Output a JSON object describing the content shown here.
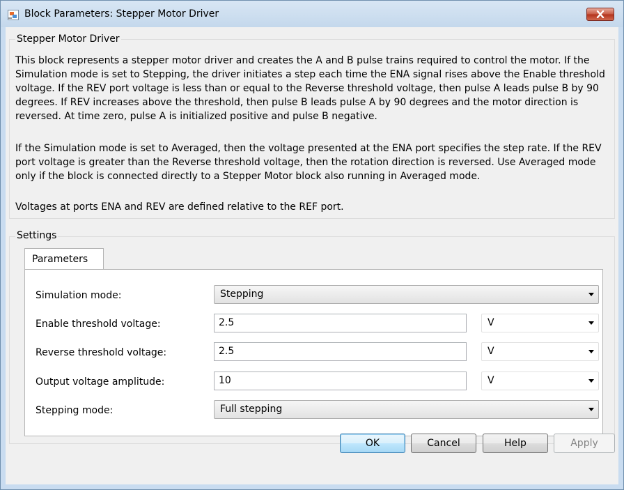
{
  "window": {
    "title": "Block Parameters: Stepper Motor Driver",
    "title_icon": "simulink-block-icon",
    "close_icon": "close-icon"
  },
  "description_group": {
    "title": "Stepper Motor Driver",
    "paragraph1": "This block represents a stepper motor driver and creates the A and B pulse trains required to control the motor. If the Simulation mode is set to Stepping, the driver initiates a step each time the ENA signal rises above the Enable threshold voltage. If the REV port voltage is less than or equal to the Reverse threshold voltage, then pulse A leads pulse B by 90 degrees. If REV increases above the threshold, then pulse B leads pulse A by 90 degrees and the motor direction is reversed. At time zero, pulse A is initialized positive and pulse B negative.",
    "paragraph2": "If the Simulation mode is set to Averaged, then the voltage presented at the ENA port specifies the step rate. If the REV port voltage is greater than the Reverse threshold voltage, then the rotation direction is reversed. Use Averaged mode only if the block is connected directly to a Stepper Motor block also running in Averaged mode.",
    "paragraph3": "Voltages at ports ENA and REV are defined relative to the REF port."
  },
  "settings": {
    "title": "Settings",
    "tab_label": "Parameters",
    "simulation_mode": {
      "label": "Simulation mode:",
      "value": "Stepping"
    },
    "enable_threshold": {
      "label": "Enable threshold voltage:",
      "value": "2.5",
      "unit": "V"
    },
    "reverse_threshold": {
      "label": "Reverse threshold voltage:",
      "value": "2.5",
      "unit": "V"
    },
    "output_amplitude": {
      "label": "Output voltage amplitude:",
      "value": "10",
      "unit": "V"
    },
    "stepping_mode": {
      "label": "Stepping mode:",
      "value": "Full stepping"
    }
  },
  "buttons": {
    "ok": "OK",
    "cancel": "Cancel",
    "help": "Help",
    "apply": "Apply"
  },
  "colors": {
    "titlebar": "#c9dcf0",
    "client": "#f0f0f0",
    "close_button": "#c75a43",
    "ok_border": "#3c7fb1"
  }
}
